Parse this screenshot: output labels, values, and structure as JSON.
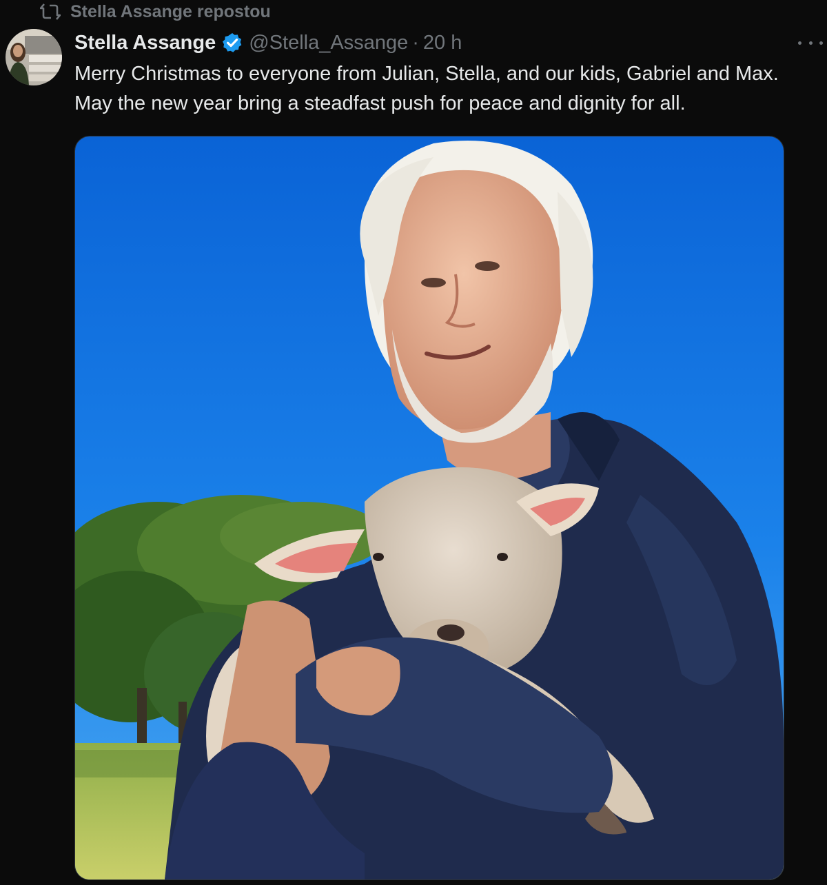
{
  "social_context": {
    "icon": "repost-icon",
    "text": "Stella Assange repostou"
  },
  "author": {
    "name": "Stella Assange",
    "handle": "@Stella_Assange",
    "separator": "·",
    "time": "20 h",
    "verified_color": "#1d9bf0"
  },
  "post": {
    "text": "Merry Christmas to everyone from Julian, Stella, and our kids, Gabriel and Max. May the new year bring a steadfast push for peace and dignity for all."
  },
  "colors": {
    "background": "#0b0b0b",
    "text_primary": "#e7e9ea",
    "text_secondary": "#71767b",
    "accent": "#1d9bf0"
  }
}
